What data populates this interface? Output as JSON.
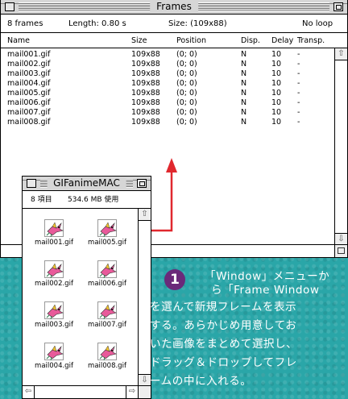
{
  "frames_window": {
    "title": "Frames",
    "info": {
      "frame_count": "8 frames",
      "length": "Length: 0.80 s",
      "size": "Size: (109x88)",
      "loop": "No loop"
    },
    "columns": [
      "Name",
      "Size",
      "Position",
      "Disp.",
      "Delay",
      "Transp."
    ],
    "rows": [
      [
        "mail001.gif",
        "109x88",
        "(0; 0)",
        "N",
        "10",
        "-"
      ],
      [
        "mail002.gif",
        "109x88",
        "(0; 0)",
        "N",
        "10",
        "-"
      ],
      [
        "mail003.gif",
        "109x88",
        "(0; 0)",
        "N",
        "10",
        "-"
      ],
      [
        "mail004.gif",
        "109x88",
        "(0; 0)",
        "N",
        "10",
        "-"
      ],
      [
        "mail005.gif",
        "109x88",
        "(0; 0)",
        "N",
        "10",
        "-"
      ],
      [
        "mail006.gif",
        "109x88",
        "(0; 0)",
        "N",
        "10",
        "-"
      ],
      [
        "mail007.gif",
        "109x88",
        "(0; 0)",
        "N",
        "10",
        "-"
      ],
      [
        "mail008.gif",
        "109x88",
        "(0; 0)",
        "N",
        "10",
        "-"
      ]
    ]
  },
  "gif_window": {
    "title": "GIFanimeMAC",
    "info": {
      "items": "8 項目",
      "used": "534.6 MB 使用"
    },
    "files": [
      "mail001.gif",
      "mail005.gif",
      "mail002.gif",
      "mail006.gif",
      "mail003.gif",
      "mail007.gif",
      "mail004.gif",
      "mail008.gif"
    ]
  },
  "annotation": {
    "step": "1",
    "lines": [
      "「Window」メニューか",
      "ら「Frame Window",
      "を選んで新規フレームを表示",
      "する。あらかじめ用意してお",
      "いた画像をまとめて選択し、",
      "ドラッグ＆ドロップしてフレ",
      "ームの中に入れる。"
    ],
    "accent_color": "#e0282e",
    "step_color": "#6a2a7a"
  }
}
